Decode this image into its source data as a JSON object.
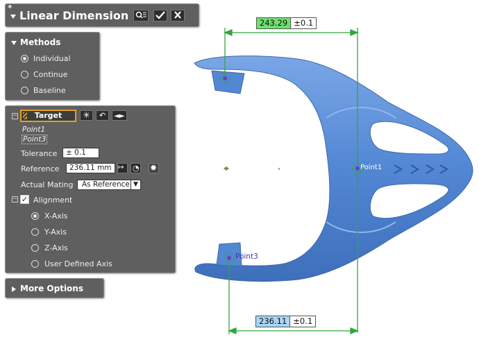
{
  "title_panel": {
    "title": "Linear Dimension"
  },
  "methods": {
    "title": "Methods",
    "options": [
      {
        "label": "Individual",
        "selected": true
      },
      {
        "label": "Continue",
        "selected": false
      },
      {
        "label": "Baseline",
        "selected": false
      }
    ]
  },
  "target": {
    "button_label": "Target",
    "points": [
      "Point1",
      "Point3"
    ],
    "tolerance_label": "Tolerance",
    "tolerance_value": "± 0.1",
    "reference_label": "Reference",
    "reference_value": "236.11 mm",
    "actual_mating_label": "Actual Mating",
    "actual_mating_value": "As Reference",
    "alignment_label": "Alignment",
    "alignment_checked": true,
    "axes": [
      {
        "label": "X-Axis",
        "selected": true
      },
      {
        "label": "Y-Axis",
        "selected": false
      },
      {
        "label": "Z-Axis",
        "selected": false
      },
      {
        "label": "User Defined Axis",
        "selected": false
      }
    ]
  },
  "more_options": {
    "label": "More Options"
  },
  "viewport": {
    "top_dimension": {
      "value": "243.29",
      "tolerance": "±0.1",
      "color": "#6ee06e"
    },
    "bottom_dimension": {
      "value": "236.11",
      "tolerance": "±0.1",
      "color": "#a8d4f5"
    },
    "point_labels": [
      "Point1",
      "Point3"
    ],
    "part_color": "#5b8fd6",
    "dimension_line_color": "#2fa83a"
  }
}
